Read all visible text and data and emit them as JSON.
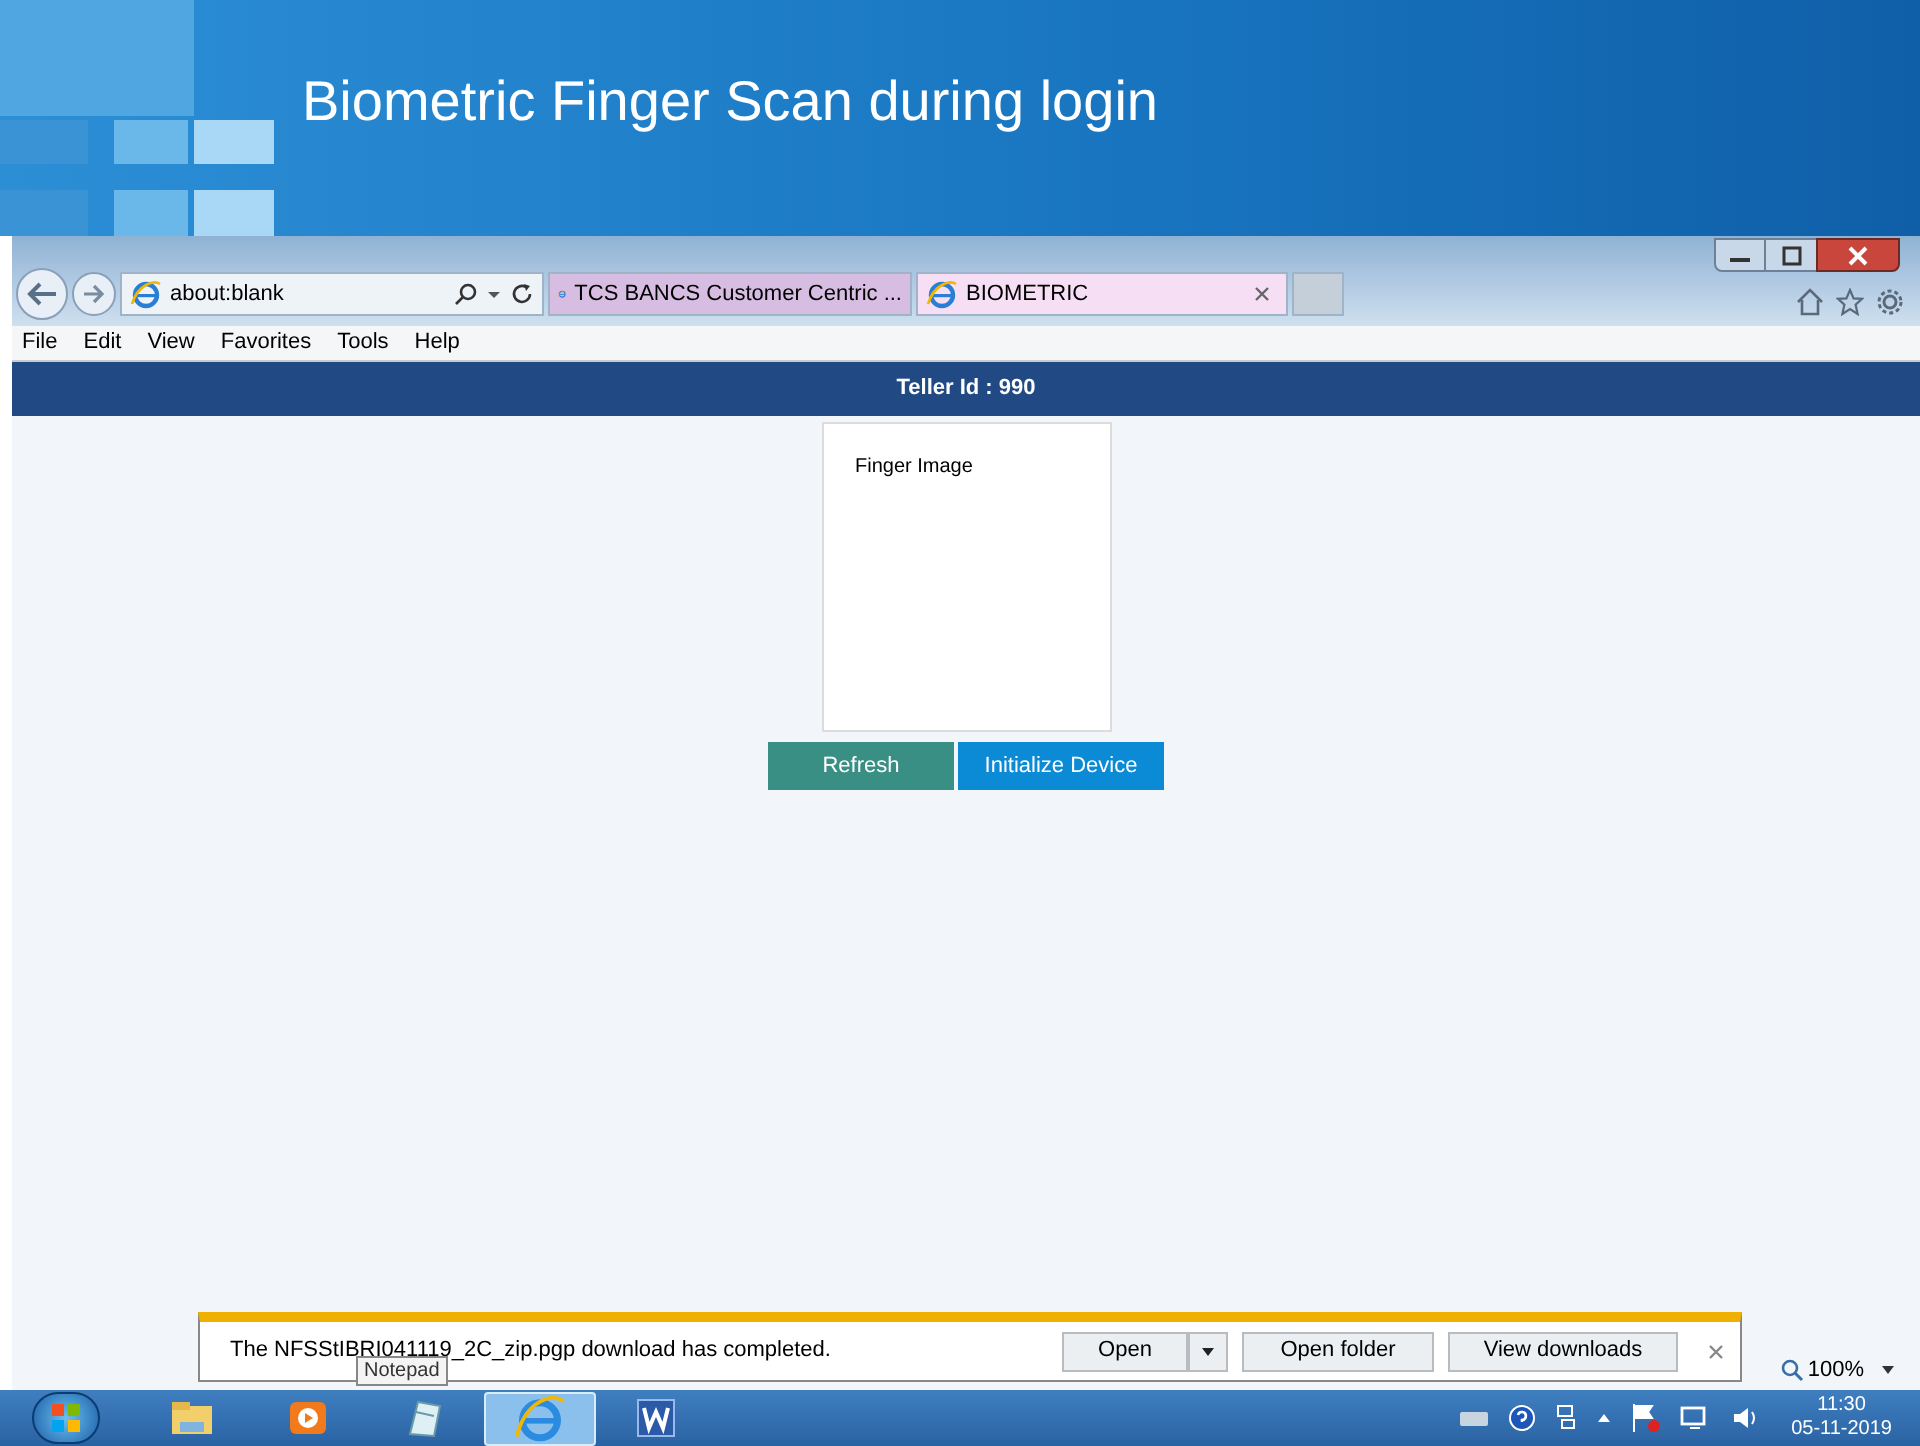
{
  "slide": {
    "title": "Biometric Finger Scan during login"
  },
  "browser": {
    "address": "about:blank",
    "tabs": [
      {
        "label": "TCS BANCS Customer Centric ...",
        "selected": false
      },
      {
        "label": "BIOMETRIC",
        "selected": true
      }
    ],
    "menu": [
      "File",
      "Edit",
      "View",
      "Favorites",
      "Tools",
      "Help"
    ],
    "zoom": "100%"
  },
  "page": {
    "header": "Teller Id : 990",
    "finger_label": "Finger Image",
    "buttons": [
      {
        "label": "Refresh",
        "kind": "secondary"
      },
      {
        "label": "Initialize Device",
        "kind": "primary"
      }
    ]
  },
  "download_bar": {
    "message": "The NFSStIBRI041119_2C_zip.pgp download has completed.",
    "buttons": [
      "Open",
      "Open folder",
      "View downloads"
    ]
  },
  "tooltip": "Notepad",
  "taskbar": {
    "apps": [
      {
        "kind": "explorer",
        "selected": false
      },
      {
        "kind": "media",
        "selected": false
      },
      {
        "kind": "notepad",
        "selected": false
      },
      {
        "kind": "ie",
        "selected": true
      },
      {
        "kind": "word",
        "selected": false
      }
    ],
    "time": "11:30",
    "date": "05-11-2019"
  }
}
